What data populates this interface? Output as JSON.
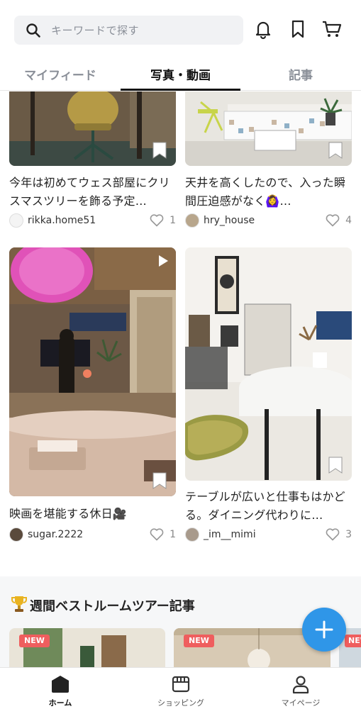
{
  "search": {
    "placeholder": "キーワードで探す"
  },
  "tabs": [
    {
      "label": "マイフィード",
      "active": false
    },
    {
      "label": "写真・動画",
      "active": true
    },
    {
      "label": "記事",
      "active": false
    }
  ],
  "posts": [
    {
      "caption": "今年は初めてウェス部屋にクリスマスツリーを飾る予定…",
      "user": "rikka.home51",
      "likes": "1"
    },
    {
      "caption": "天井を高くしたので、入った瞬間圧迫感がなく🙆‍♀️…",
      "user": "hry_house",
      "likes": "4"
    },
    {
      "caption": "映画を堪能する休日🎥",
      "user": "sugar.2222",
      "likes": "1"
    },
    {
      "caption": "テーブルが広いと仕事もはかどる。ダイニング代わりに…",
      "user": "_im__mimi",
      "likes": "3"
    }
  ],
  "weekly": {
    "title": "週間ベストルームツアー記事",
    "badge": "NEW"
  },
  "bottom_nav": [
    {
      "label": "ホーム",
      "icon": "home-icon",
      "active": true
    },
    {
      "label": "ショッピング",
      "icon": "shop-icon",
      "active": false
    },
    {
      "label": "マイページ",
      "icon": "person-icon",
      "active": false
    }
  ],
  "colors": {
    "accent": "#2f96e8",
    "badge": "#ef5e5e",
    "text": "#222222",
    "muted": "#8a8f98"
  }
}
